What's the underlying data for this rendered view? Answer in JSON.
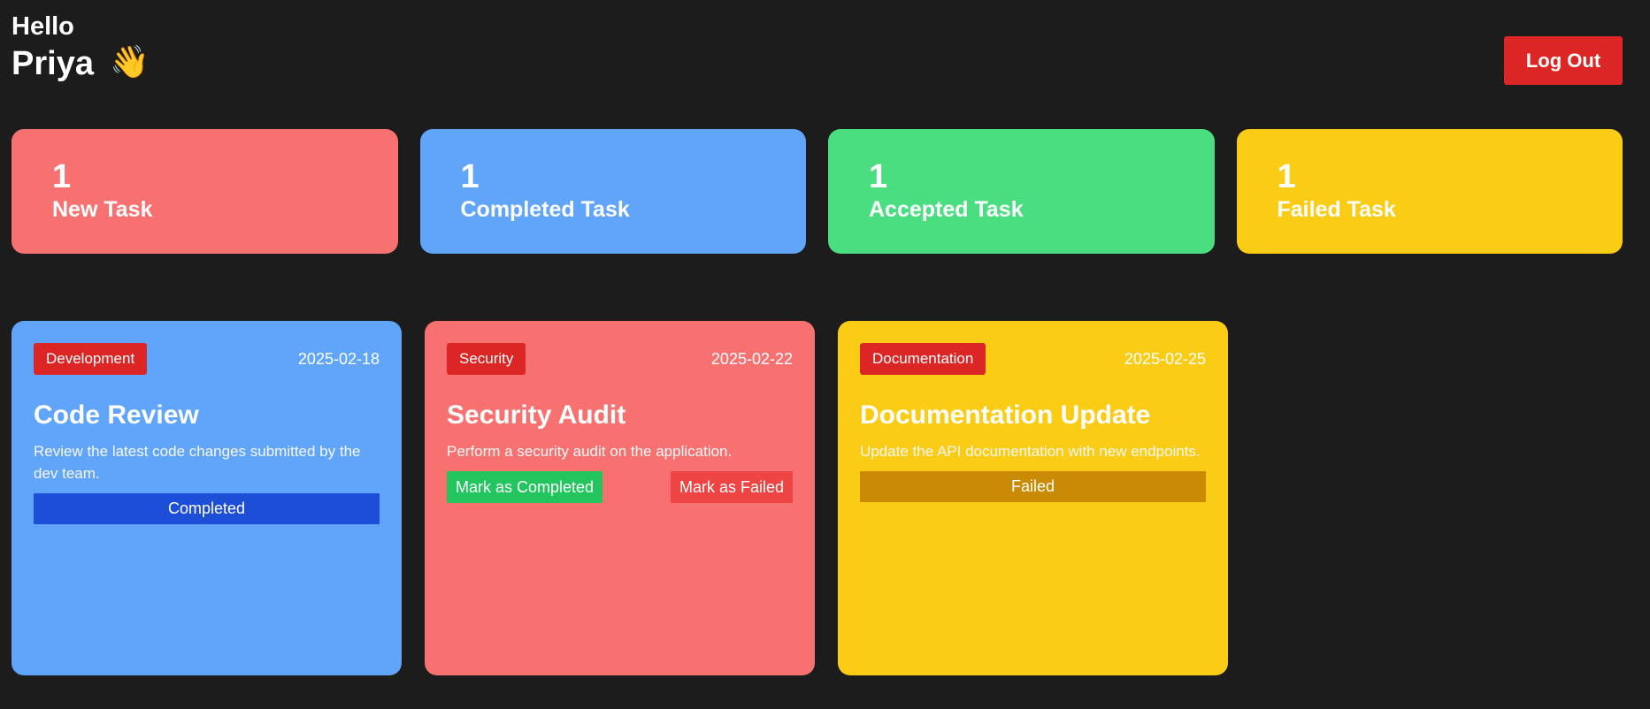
{
  "header": {
    "greeting": "Hello",
    "name": "Priya",
    "emoji": "👋",
    "logout_label": "Log Out"
  },
  "stats": [
    {
      "count": "1",
      "label": "New Task",
      "color": "#f87171"
    },
    {
      "count": "1",
      "label": "Completed Task",
      "color": "#60a5fa"
    },
    {
      "count": "1",
      "label": "Accepted Task",
      "color": "#4ade80"
    },
    {
      "count": "1",
      "label": "Failed Task",
      "color": "#facc15"
    }
  ],
  "tasks": [
    {
      "category": "Development",
      "date": "2025-02-18",
      "title": "Code Review",
      "description": "Review the latest code changes submitted by the dev team.",
      "status": "Completed",
      "card_color": "#60a5fa",
      "status_color": "#1d4ed8"
    },
    {
      "category": "Security",
      "date": "2025-02-22",
      "title": "Security Audit",
      "description": "Perform a security audit on the application.",
      "actions": {
        "complete_label": "Mark as Completed",
        "fail_label": "Mark as Failed"
      },
      "card_color": "#f87171",
      "complete_color": "#22c55e",
      "fail_color": "#ef4444"
    },
    {
      "category": "Documentation",
      "date": "2025-02-25",
      "title": "Documentation Update",
      "description": "Update the API documentation with new endpoints.",
      "status": "Failed",
      "card_color": "#facc15",
      "status_color": "#ca8a04"
    }
  ]
}
